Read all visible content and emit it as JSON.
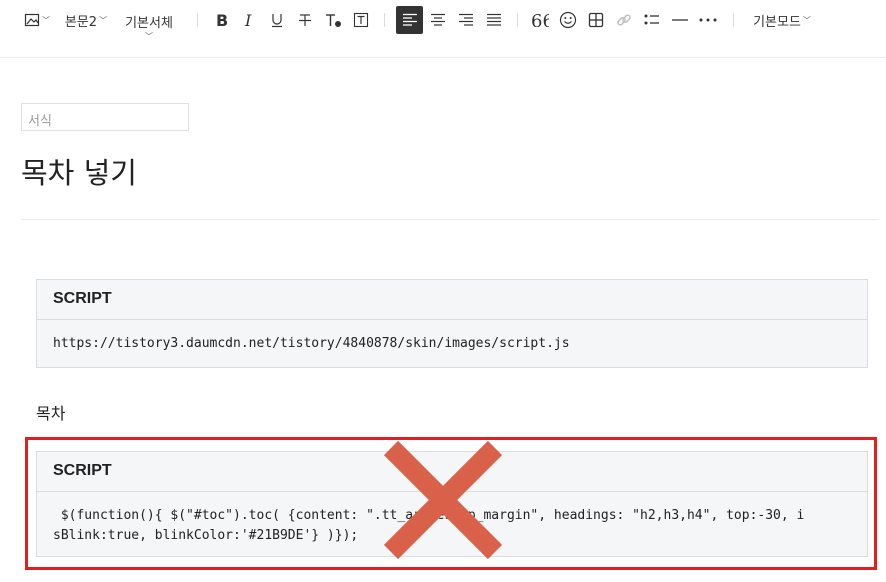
{
  "toolbar": {
    "style_label": "본문2",
    "font_label": "기본서체",
    "mode_label": "기본모드",
    "icons": [
      "image-icon",
      "bold-icon",
      "italic-icon",
      "underline-icon",
      "strikethrough-icon",
      "text-color-icon",
      "text-background-icon",
      "align-left-icon",
      "align-center-icon",
      "align-right-icon",
      "align-justify-icon",
      "quote-icon",
      "emoji-icon",
      "table-icon",
      "link-icon",
      "list-icon",
      "divider-icon",
      "more-icon"
    ],
    "active_color": "#333333"
  },
  "editor": {
    "format_placeholder": "서식",
    "title": "목차 넣기",
    "blocks": [
      {
        "header": "SCRIPT",
        "content": "https://tistory3.daumcdn.net/tistory/4840878/skin/images/script.js"
      },
      {
        "header": "SCRIPT",
        "content_line1": " $(function(){ $(\"#toc\").toc( {content: \".tt_ar",
        "content_hidden": "ticle_useless_p_margin",
        "content_line1b": "eless_p_margin\", headings: \"h2,h3,h4\", top:-30, i",
        "content_line2": "sBlink:true, blinkColor:'#21B9DE'} )});"
      }
    ],
    "toc_label": "목차"
  },
  "annotation": {
    "box_color": "#e02020",
    "x_color": "#d9614a"
  }
}
